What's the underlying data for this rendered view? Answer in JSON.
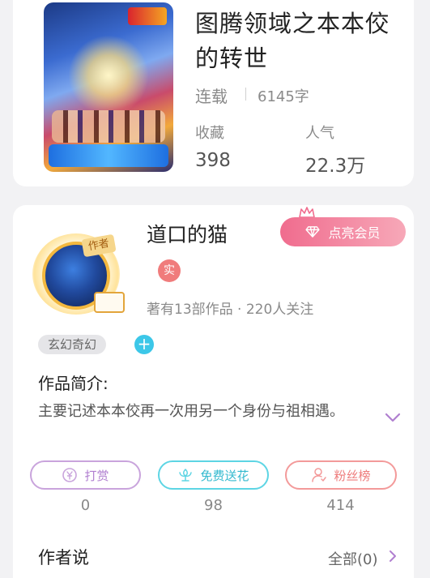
{
  "book": {
    "title": "图腾领域之本本佼的转世",
    "status": "连载",
    "word_count": "6145字",
    "favorites_label": "收藏",
    "favorites_value": "398",
    "popularity_label": "人气",
    "popularity_value": "22.3万"
  },
  "author": {
    "avatar_tag": "作者",
    "name": "道口的猫",
    "verified_badge": "实",
    "meta": "著有13部作品 · 220人关注",
    "vip_button": "点亮会员"
  },
  "tags": [
    "玄幻奇幻"
  ],
  "add_tag_label": "+",
  "intro": {
    "heading": "作品简介:",
    "text": "主要记述本本佼再一次用另一个身份与祖相遇。"
  },
  "actions": [
    {
      "label": "打赏",
      "count": "0",
      "icon": "yen-coin-icon"
    },
    {
      "label": "免费送花",
      "count": "98",
      "icon": "flower-icon"
    },
    {
      "label": "粉丝榜",
      "count": "414",
      "icon": "person-icon"
    }
  ],
  "author_says": {
    "heading": "作者说",
    "all_label": "全部(0)"
  },
  "colors": {
    "vip_gradient_start": "#f06c8e",
    "reward_accent": "#b07fd0",
    "flower_accent": "#33b9cf",
    "fans_accent": "#ee7b7b",
    "expand_accent": "#b07fd0"
  }
}
